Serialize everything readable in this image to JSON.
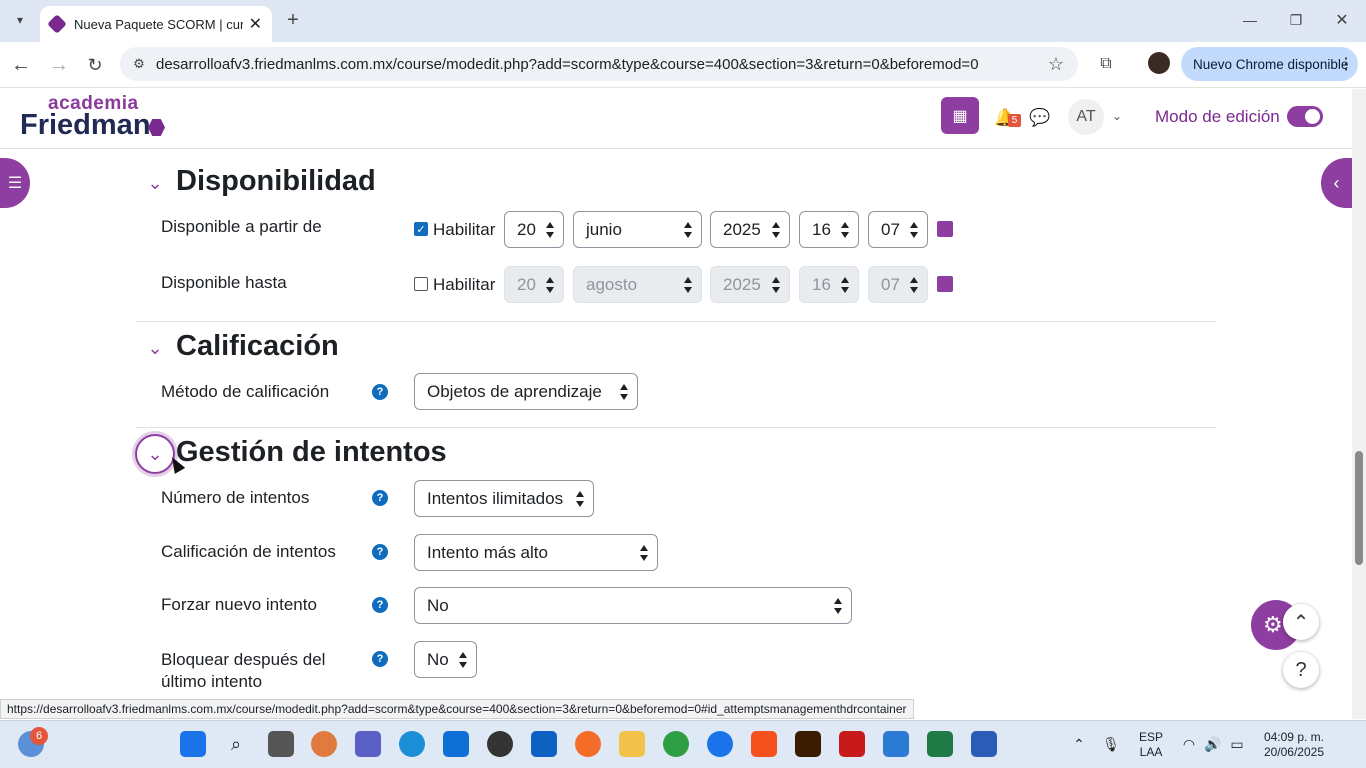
{
  "browser": {
    "tab_title": "Nueva Paquete SCORM | curso",
    "url": "desarrolloafv3.friedmanlms.com.mx/course/modedit.php?add=scorm&type&course=400&section=3&return=0&beforemod=0",
    "update_label": "Nuevo Chrome disponible",
    "status_url": "https://desarrolloafv3.friedmanlms.com.mx/course/modedit.php?add=scorm&type&course=400&section=3&return=0&beforemod=0#id_attemptsmanagementhdrcontainer"
  },
  "header": {
    "logo_top": "academia",
    "logo_bottom": "Friedman",
    "notif_count": "5",
    "avatar": "AT",
    "edit_mode_label": "Modo de edición"
  },
  "sections": {
    "disponibilidad": {
      "title": "Disponibilidad",
      "from_label": "Disponible a partir de",
      "from_enable": "Habilitar",
      "from_day": "20",
      "from_month": "junio",
      "from_year": "2025",
      "from_hour": "16",
      "from_min": "07",
      "until_label": "Disponible hasta",
      "until_enable": "Habilitar",
      "until_day": "20",
      "until_month": "agosto",
      "until_year": "2025",
      "until_hour": "16",
      "until_min": "07"
    },
    "calificacion": {
      "title": "Calificación",
      "method_label": "Método de calificación",
      "method_value": "Objetos de aprendizaje"
    },
    "intentos": {
      "title": "Gestión de intentos",
      "num_label": "Número de intentos",
      "num_value": "Intentos ilimitados",
      "grade_label": "Calificación de intentos",
      "grade_value": "Intento más alto",
      "force_label": "Forzar nuevo intento",
      "force_value": "No",
      "lock_label_1": "Bloquear después del",
      "lock_label_2": "último intento",
      "lock_value": "No"
    }
  },
  "taskbar": {
    "weather_badge": "6",
    "lang_1": "ESP",
    "lang_2": "LAA",
    "time": "04:09 p. m.",
    "date": "20/06/2025"
  },
  "colors": {
    "accent": "#8e3ea0",
    "link": "#0f6cbf"
  }
}
